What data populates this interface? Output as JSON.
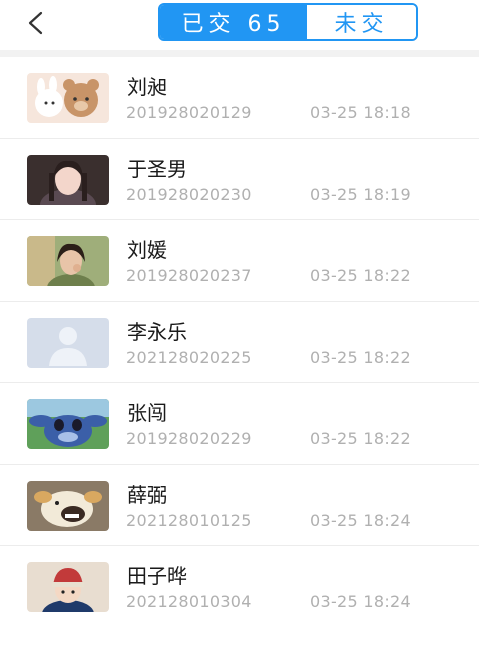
{
  "header": {
    "tabs": [
      {
        "label": "已交 65",
        "active": true
      },
      {
        "label": "未交",
        "active": false
      }
    ]
  },
  "colors": {
    "accent": "#2196f3"
  },
  "students": [
    {
      "name": "刘昶",
      "student_id": "201928020129",
      "time": "03-25 18:18",
      "avatar": "bear-avatar"
    },
    {
      "name": "于圣男",
      "student_id": "201928020230",
      "time": "03-25 18:19",
      "avatar": "girl-avatar"
    },
    {
      "name": "刘媛",
      "student_id": "201928020237",
      "time": "03-25 18:22",
      "avatar": "girl-avatar"
    },
    {
      "name": "李永乐",
      "student_id": "202128020225",
      "time": "03-25 18:22",
      "avatar": "default-user-avatar"
    },
    {
      "name": "张闯",
      "student_id": "201928020229",
      "time": "03-25 18:22",
      "avatar": "stitch-avatar"
    },
    {
      "name": "薛弼",
      "student_id": "202128010125",
      "time": "03-25 18:24",
      "avatar": "dog-avatar"
    },
    {
      "name": "田子晔",
      "student_id": "202128010304",
      "time": "03-25 18:24",
      "avatar": "child-avatar"
    }
  ]
}
